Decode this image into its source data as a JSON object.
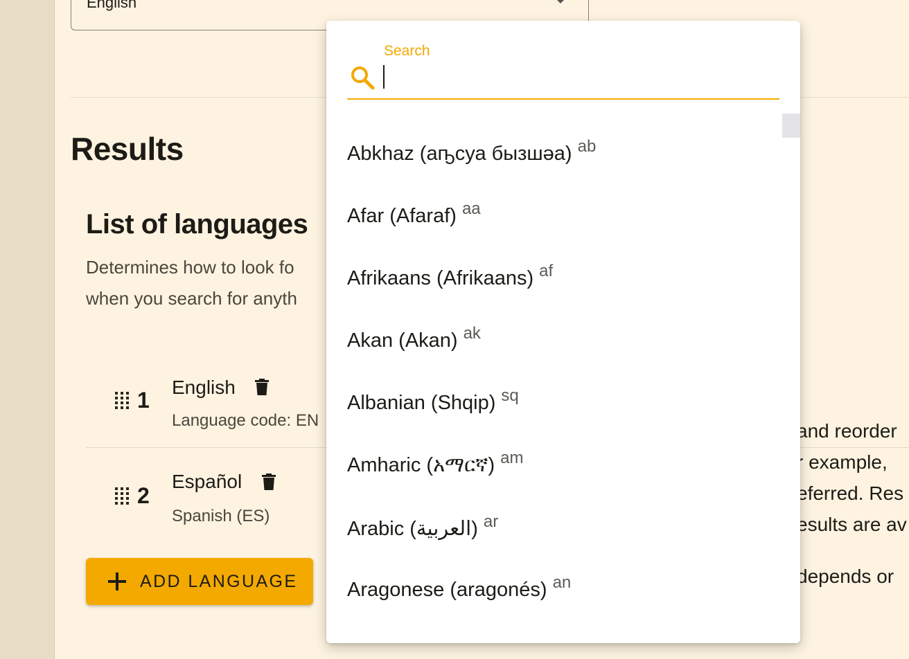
{
  "language_select": {
    "value": "English"
  },
  "results": {
    "title": "Results",
    "section_title": "List of languages",
    "description_line1": "Determines how to look fo",
    "description_line2": "when you search for anyth"
  },
  "rows": [
    {
      "num": "1",
      "name": "English",
      "sub": "Language code: EN"
    },
    {
      "num": "2",
      "name": "Español",
      "sub": "Spanish (ES)"
    }
  ],
  "add_button": {
    "label": "ADD LANGUAGE"
  },
  "right_text": [
    "and reorder",
    "r example,",
    "eferred. Res",
    "esults are av",
    "depends or"
  ],
  "dropdown": {
    "search_label": "Search",
    "search_value": "",
    "languages": [
      {
        "name": "Abkhaz (аҧсуа бызшәа)",
        "code": "ab"
      },
      {
        "name": "Afar (Afaraf)",
        "code": "aa"
      },
      {
        "name": "Afrikaans (Afrikaans)",
        "code": "af"
      },
      {
        "name": "Akan (Akan)",
        "code": "ak"
      },
      {
        "name": "Albanian (Shqip)",
        "code": "sq"
      },
      {
        "name": "Amharic (አማርኛ)",
        "code": "am"
      },
      {
        "name": "Arabic (العربية)",
        "code": "ar"
      },
      {
        "name": "Aragonese (aragonés)",
        "code": "an"
      }
    ]
  },
  "colors": {
    "accent": "#f3a900",
    "background": "#fdf3e0",
    "rail": "#e9dcc7"
  }
}
